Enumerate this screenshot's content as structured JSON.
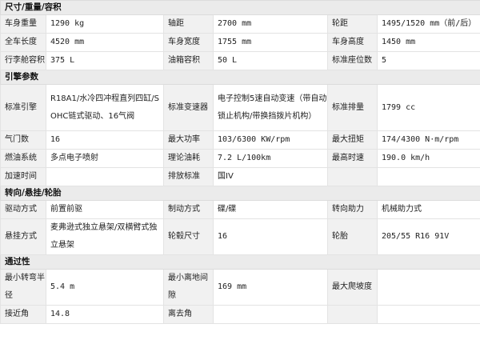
{
  "sections": {
    "dims": {
      "title": "尺寸/重量/容积",
      "r1": {
        "l1": "车身重量",
        "v1": "1290 kg",
        "l2": "轴距",
        "v2": "2700 mm",
        "l3": "轮距",
        "v3": "1495/1520 mm（前/后）"
      },
      "r2": {
        "l1": "全车长度",
        "v1": "4520 mm",
        "l2": "车身宽度",
        "v2": "1755 mm",
        "l3": "车身高度",
        "v3": "1450 mm"
      },
      "r3": {
        "l1": "行李舱容积",
        "v1": "375 L",
        "l2": "油箱容积",
        "v2": "50 L",
        "l3": "标准座位数",
        "v3": "5"
      }
    },
    "engine": {
      "title": "引擎参数",
      "r1": {
        "l1": "标准引擎",
        "v1": "R18A1/水冷四冲程直列四缸/SOHC链式驱动、16气阀",
        "l2": "标准变速器",
        "v2": "电子控制5速自动变速（带自动锁止机构/带换挡拨片机构）",
        "l3": "标准排量",
        "v3": "1799 cc"
      },
      "r2": {
        "l1": "气门数",
        "v1": "16",
        "l2": "最大功率",
        "v2": "103/6300 KW/rpm",
        "l3": "最大扭矩",
        "v3": "174/4300 N·m/rpm"
      },
      "r3": {
        "l1": "燃油系统",
        "v1": "多点电子喷射",
        "l2": "理论油耗",
        "v2": "7.2 L/100km",
        "l3": "最高时速",
        "v3": "190.0 km/h"
      },
      "r4": {
        "l1": "加速时间",
        "v1": "",
        "l2": "排放标准",
        "v2": "国IV",
        "l3": "",
        "v3": ""
      }
    },
    "steering": {
      "title": "转向/悬挂/轮胎",
      "r1": {
        "l1": "驱动方式",
        "v1": "前置前驱",
        "l2": "制动方式",
        "v2": "碟/碟",
        "l3": "转向助力",
        "v3": "机械助力式"
      },
      "r2": {
        "l1": "悬挂方式",
        "v1": "麦弗逊式独立悬架/双横臂式独立悬架",
        "l2": "轮毂尺寸",
        "v2": "16",
        "l3": "轮胎",
        "v3": "205/55 R16 91V"
      }
    },
    "passability": {
      "title": "通过性",
      "r1": {
        "l1": "最小转弯半径",
        "v1": "5.4 m",
        "l2": "最小离地间隙",
        "v2": "169 mm",
        "l3": "最大爬坡度",
        "v3": ""
      },
      "r2": {
        "l1": "接近角",
        "v1": "14.8",
        "l2": "离去角",
        "v2": "",
        "l3": "",
        "v3": ""
      }
    }
  }
}
